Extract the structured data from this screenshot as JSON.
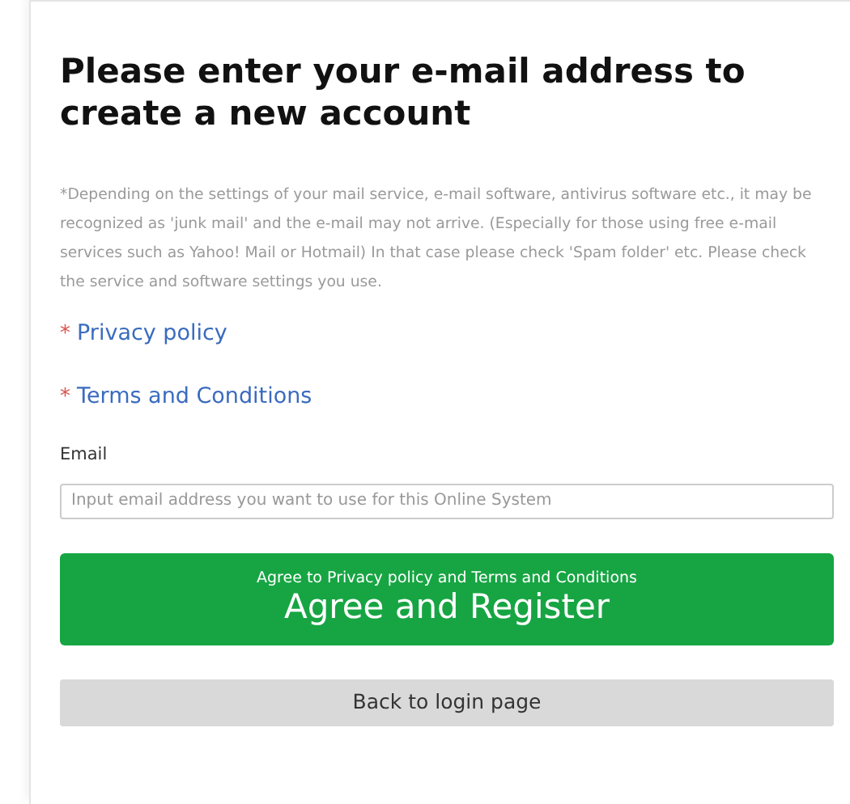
{
  "title": "Please enter your e-mail address to create a new account",
  "notice": "*Depending on the settings of your mail service, e-mail software, antivirus software etc., it may be recognized as 'junk mail' and the e-mail may not arrive. (Especially for those using free e-mail services such as Yahoo! Mail or Hotmail) In that case please check 'Spam folder' etc. Please check the service and software settings you use.",
  "links": [
    {
      "marker": "*",
      "label": "Privacy policy"
    },
    {
      "marker": "*",
      "label": "Terms and Conditions"
    }
  ],
  "email": {
    "label": "Email",
    "placeholder": "Input email address you want to use for this Online System"
  },
  "register_button": {
    "caption": "Agree to Privacy policy and Terms and Conditions",
    "label": "Agree and Register"
  },
  "back_button": {
    "label": "Back to login page"
  }
}
